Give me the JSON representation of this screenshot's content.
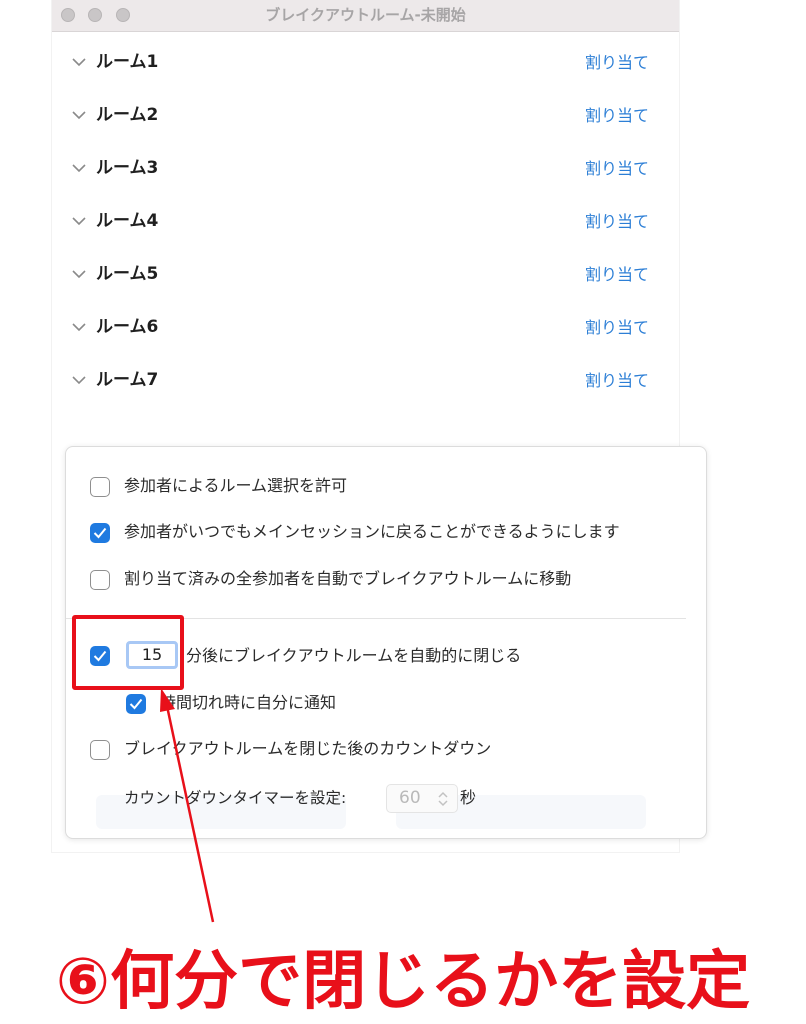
{
  "window": {
    "title": "ブレイクアウトルーム-未開始"
  },
  "rooms": [
    {
      "name": "ルーム1",
      "action": "割り当て"
    },
    {
      "name": "ルーム2",
      "action": "割り当て"
    },
    {
      "name": "ルーム3",
      "action": "割り当て"
    },
    {
      "name": "ルーム4",
      "action": "割り当て"
    },
    {
      "name": "ルーム5",
      "action": "割り当て"
    },
    {
      "name": "ルーム6",
      "action": "割り当て"
    },
    {
      "name": "ルーム7",
      "action": "割り当て"
    }
  ],
  "options": {
    "allow_choose": {
      "label": "参加者によるルーム選択を許可",
      "checked": false
    },
    "allow_return": {
      "label": "参加者がいつでもメインセッションに戻ることができるようにします",
      "checked": true
    },
    "auto_move": {
      "label": "割り当て済みの全参加者を自動でブレイクアウトルームに移動",
      "checked": false
    },
    "auto_close": {
      "label": "分後にブレイクアウトルームを自動的に閉じる",
      "checked": true,
      "minutes": "15"
    },
    "notify": {
      "label": "時間切れ時に自分に通知",
      "checked": true
    },
    "countdown": {
      "label": "ブレイクアウトルームを閉じた後のカウントダウン",
      "checked": false
    },
    "countdown_timer": {
      "label": "カウントダウンタイマーを設定:",
      "value": "60",
      "unit": "秒"
    }
  },
  "annotation": {
    "caption": "⑥何分で閉じるかを設定",
    "color": "#e8101a"
  },
  "colors": {
    "accent": "#1f7ae0",
    "link": "#2d7fd6"
  }
}
